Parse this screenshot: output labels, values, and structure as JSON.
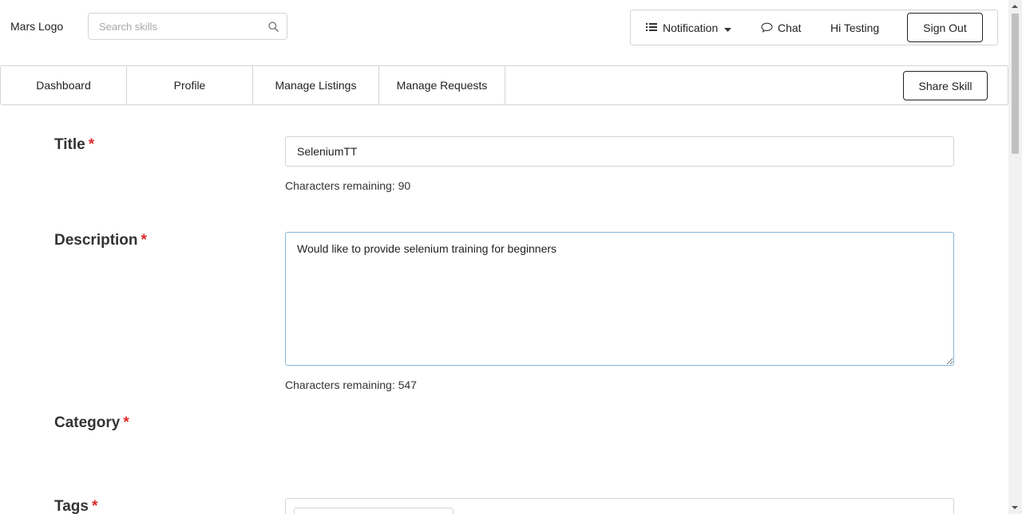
{
  "header": {
    "logo": "Mars Logo",
    "search_placeholder": "Search skills",
    "notification_label": "Notification",
    "chat_label": "Chat",
    "greeting": "Hi Testing",
    "signout_label": "Sign Out"
  },
  "nav": {
    "tabs": [
      {
        "label": "Dashboard"
      },
      {
        "label": "Profile"
      },
      {
        "label": "Manage Listings"
      },
      {
        "label": "Manage Requests"
      }
    ],
    "share_label": "Share Skill"
  },
  "form": {
    "required_mark": "*",
    "title": {
      "label": "Title",
      "value": "SeleniumTT",
      "remaining": "Characters remaining: 90"
    },
    "description": {
      "label": "Description",
      "value": "Would like to provide selenium training for beginners",
      "remaining": "Characters remaining: 547"
    },
    "category": {
      "label": "Category"
    },
    "tags": {
      "label": "Tags"
    }
  },
  "colors": {
    "required": "#db2828",
    "focus_border": "#85b7d9",
    "border": "#d4d4d5"
  }
}
